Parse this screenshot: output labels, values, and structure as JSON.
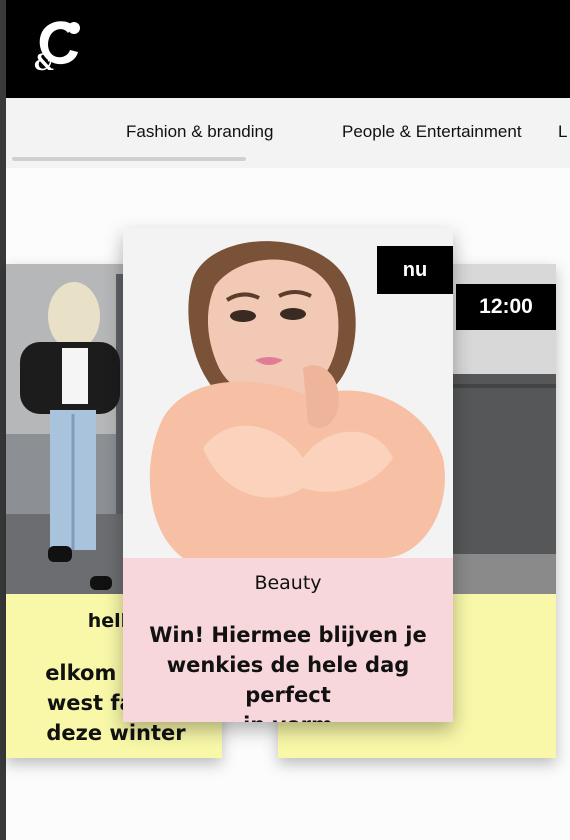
{
  "header": {
    "logo_icon": "ampersand-c-logo",
    "background": "#000000"
  },
  "nav": {
    "items": [
      {
        "label": "Fashion & branding"
      },
      {
        "label": "People & Entertainment"
      },
      {
        "label": "L"
      }
    ]
  },
  "cards": {
    "left": {
      "category": "hello",
      "headline_lines": [
        "elkom wat z",
        "west fahion",
        "deze winter"
      ],
      "bg": "#f8f8a8"
    },
    "center": {
      "badge": "nu",
      "category": "Beauty",
      "headline_lines": [
        "Win! Hiermee blijven je",
        "wenkies de hele dag perfect",
        "in vorm"
      ],
      "bg": "#f8d7dc"
    },
    "right": {
      "badge": "12:00",
      "bg": "#f8f8a8"
    }
  }
}
